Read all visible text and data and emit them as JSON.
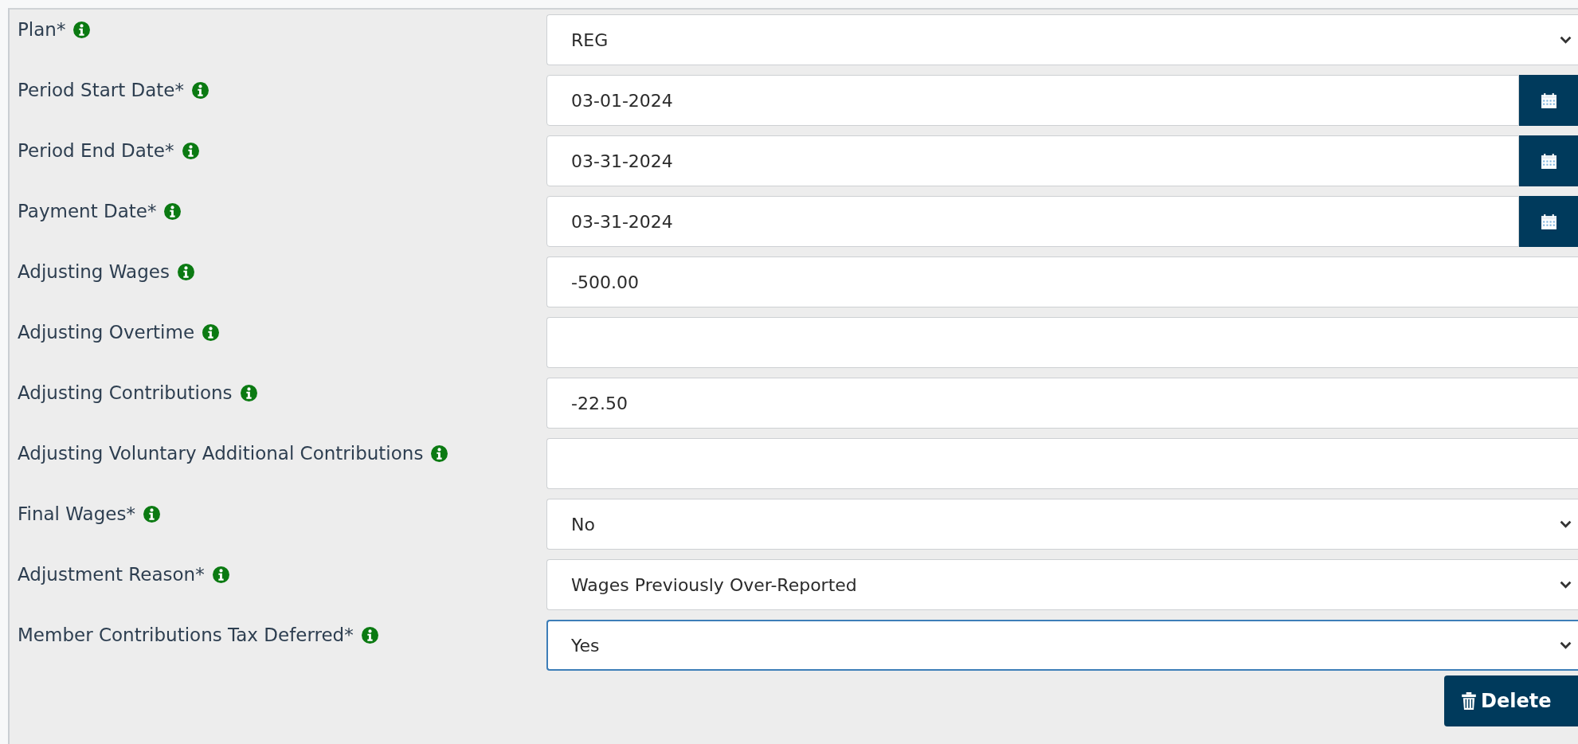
{
  "fields": [
    {
      "label": "Plan*",
      "kind": "select",
      "value": "REG",
      "focused": false
    },
    {
      "label": "Period Start Date*",
      "kind": "date",
      "value": "03-01-2024",
      "focused": false
    },
    {
      "label": "Period End Date*",
      "kind": "date",
      "value": "03-31-2024",
      "focused": false
    },
    {
      "label": "Payment Date*",
      "kind": "date",
      "value": "03-31-2024",
      "focused": false
    },
    {
      "label": "Adjusting Wages",
      "kind": "text",
      "value": "-500.00",
      "focused": false
    },
    {
      "label": "Adjusting Overtime",
      "kind": "text",
      "focused": false
    },
    {
      "label": "Adjusting Contributions",
      "kind": "text",
      "value": "-22.50",
      "focused": false
    },
    {
      "label": "Adjusting Voluntary Additional Contributions",
      "kind": "text",
      "focused": false
    },
    {
      "label": "Final Wages*",
      "kind": "select",
      "value": "No",
      "focused": false
    },
    {
      "label": "Adjustment Reason*",
      "kind": "select",
      "value": "Wages Previously Over-Reported",
      "focused": false
    },
    {
      "label": "Member Contributions Tax Deferred*",
      "kind": "select",
      "value": "Yes",
      "focused": true
    }
  ],
  "delete_button": {
    "label": "Delete"
  }
}
